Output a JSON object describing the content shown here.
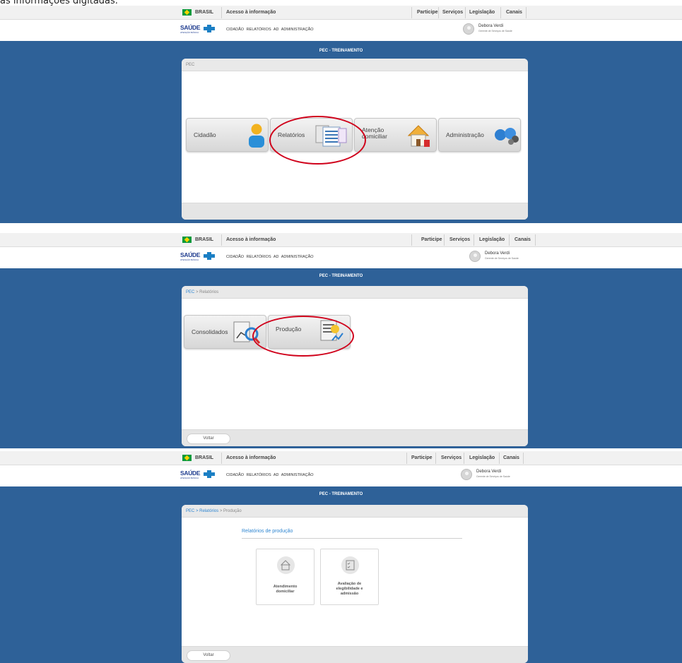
{
  "caption": "as informações digitadas.",
  "govbar": {
    "brasil": "BRASIL",
    "acesso": "Acesso à informação",
    "nav": [
      "Participe",
      "Serviços",
      "Legislação",
      "Canais"
    ]
  },
  "appbar": {
    "logo_text": "SAÚDE",
    "logo_sub": "ATENÇÃO BÁSICA",
    "menu": "CIDADÃO   RELATÓRIOS   AD   ADMINISTRAÇÃO",
    "user_name": "Debora Verdi",
    "user_role": "Gerente de Serviços de Saúde"
  },
  "env_title": "PEC - TREINAMENTO",
  "panel1": {
    "breadcrumb": "PEC",
    "tiles": [
      "Cidadão",
      "Relatórios",
      "Atenção domiciliar",
      "Administração"
    ],
    "tile2_line1": "Atenção",
    "tile2_line2": "domiciliar"
  },
  "panel2": {
    "breadcrumb_root": "PEC",
    "breadcrumb_current": " > Relatórios",
    "tiles": [
      "Consolidados",
      "Produção"
    ],
    "back": "Voltar"
  },
  "panel3": {
    "breadcrumb_root": "PEC",
    "breadcrumb_mid": " > Relatórios",
    "breadcrumb_current": " > Produção",
    "section_title": "Relatórios de produção",
    "cards": [
      {
        "line1": "Atendimento",
        "line2": "domiciliar",
        "line3": ""
      },
      {
        "line1": "Avaliação de",
        "line2": "elegibilidade e",
        "line3": "admissão"
      }
    ],
    "back": "Voltar"
  },
  "colors": {
    "background_blue": "#2e6198",
    "highlight_red": "#d0021b",
    "link_blue": "#2f86d1"
  }
}
